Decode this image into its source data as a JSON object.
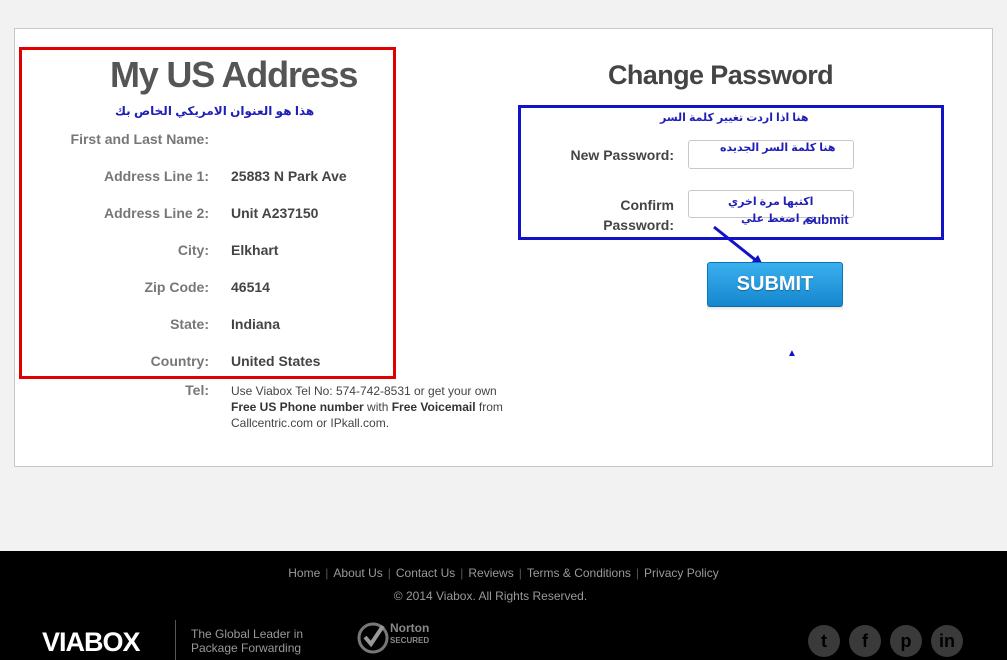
{
  "address": {
    "title": "My US Address",
    "note_arabic": "هذا هو العنوان الامريكي الخاص بك",
    "fields": [
      {
        "label": "First and Last Name:",
        "value": ""
      },
      {
        "label": "Address Line 1:",
        "value": "25883 N Park Ave"
      },
      {
        "label": "Address Line 2:",
        "value": "Unit A237150"
      },
      {
        "label": "City:",
        "value": "Elkhart"
      },
      {
        "label": "Zip Code:",
        "value": "46514"
      },
      {
        "label": "State:",
        "value": "Indiana"
      },
      {
        "label": "Country:",
        "value": "United States"
      }
    ],
    "tel_label": "Tel:",
    "tel_line1": "Use Viabox Tel No: 574-742-8531 or get your own",
    "tel_free_phone": "Free US Phone number",
    "tel_with": " with ",
    "tel_free_voicemail": "Free Voicemail",
    "tel_from": " from",
    "tel_callcentric": "Callcentric.com",
    "tel_or": " or ",
    "tel_ipkall": "IPkall.com",
    "tel_end": "."
  },
  "password": {
    "title": "Change Password",
    "note_arabic": "هنا اذا اردت تغيير كلمة السر",
    "new_label": "New Password:",
    "new_hint_arabic": "هنا كلمة السر الجديده",
    "confirm_label_1": "Confirm",
    "confirm_label_2": "Password:",
    "confirm_hint_arabic": "اكتبها مرة اخري",
    "submit_hint_arabic": "تم اضغط علي",
    "submit_hint_word": "submit",
    "submit_label": "SUBMIT"
  },
  "footer": {
    "links": [
      "Home",
      "About Us",
      "Contact Us",
      "Reviews",
      "Terms & Conditions",
      "Privacy Policy"
    ],
    "copyright": "© 2014 Viabox. All Rights Reserved.",
    "logo": "VIABOX",
    "tagline_1": "The Global Leader in",
    "tagline_2": "Package Forwarding",
    "norton_1": "Norton",
    "norton_2": "SECURED",
    "social": [
      "twitter-icon",
      "facebook-icon",
      "pinterest-icon",
      "linkedin-icon"
    ]
  },
  "colors": {
    "annotation_red": "#e00000",
    "annotation_blue": "#1212c8",
    "submit": "#1f9be0"
  }
}
